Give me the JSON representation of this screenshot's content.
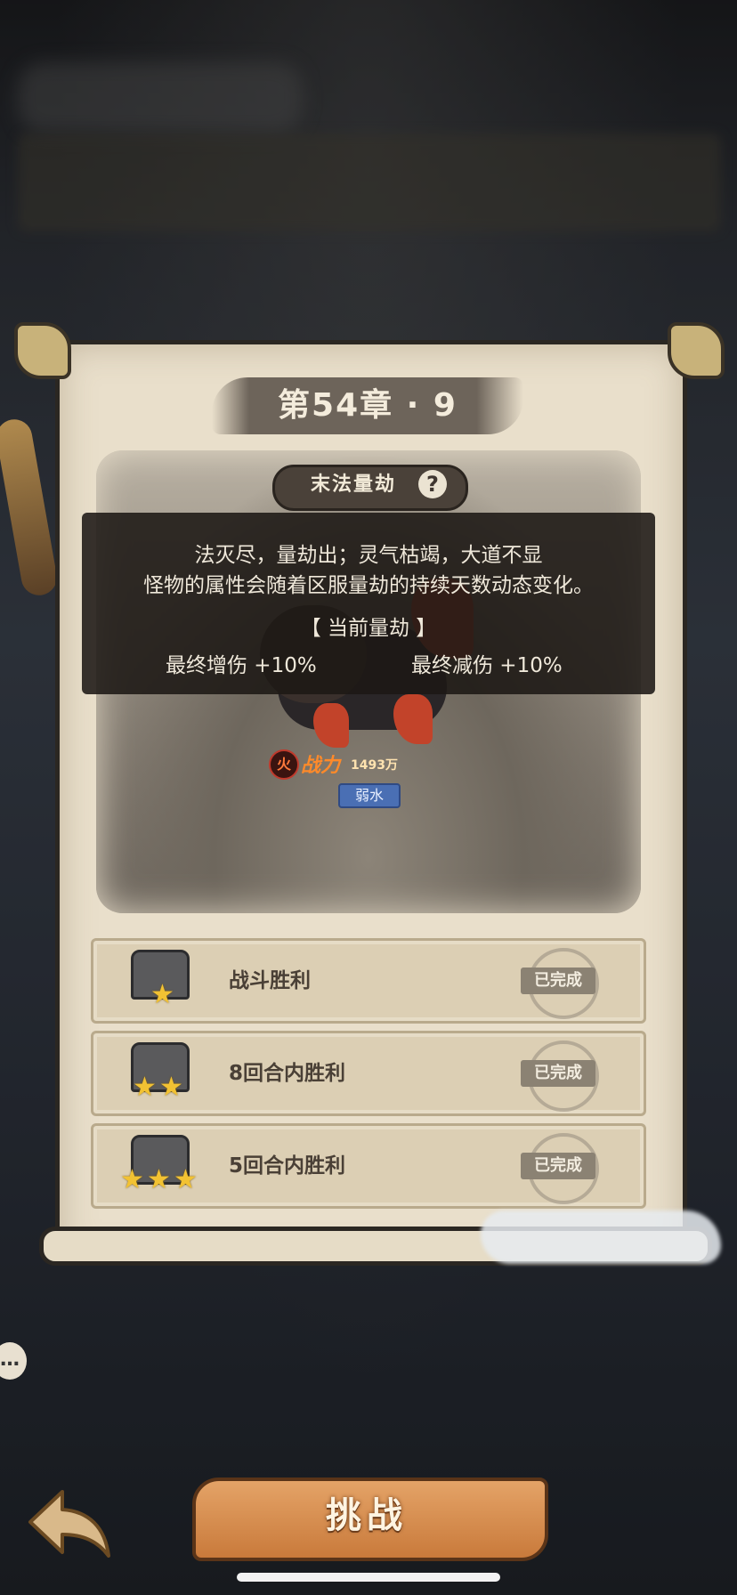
{
  "stage": {
    "title": "第54章 · 9",
    "mode_tag": "末法量劫",
    "help_symbol": "?"
  },
  "popup": {
    "line1": "法灭尽，量劫出；灵气枯竭，大道不显",
    "line2": "怪物的属性会随着区服量劫的持续天数动态变化。",
    "section": "【 当前量劫 】",
    "stat_left": "最终增伤 +10%",
    "stat_right": "最终减伤 +10%"
  },
  "enemy": {
    "element": "火",
    "power_label": "战力",
    "power_value": "1493万",
    "weakness": "弱水"
  },
  "objectives": [
    {
      "label": "战斗胜利",
      "stars": 1,
      "status": "已完成"
    },
    {
      "label": "8回合内胜利",
      "stars": 2,
      "status": "已完成"
    },
    {
      "label": "5回合内胜利",
      "stars": 3,
      "status": "已完成"
    }
  ],
  "buttons": {
    "challenge": "挑战",
    "back_icon": "back-arrow-icon",
    "chat_icon": "chat-bubble-icon"
  },
  "colors": {
    "scroll": "#e9dfcb",
    "title_band": "#6d645a",
    "done_badge": "#8b8273",
    "star": "#f2c233",
    "power": "#ff8a2a",
    "challenge": "#c97a3b"
  }
}
